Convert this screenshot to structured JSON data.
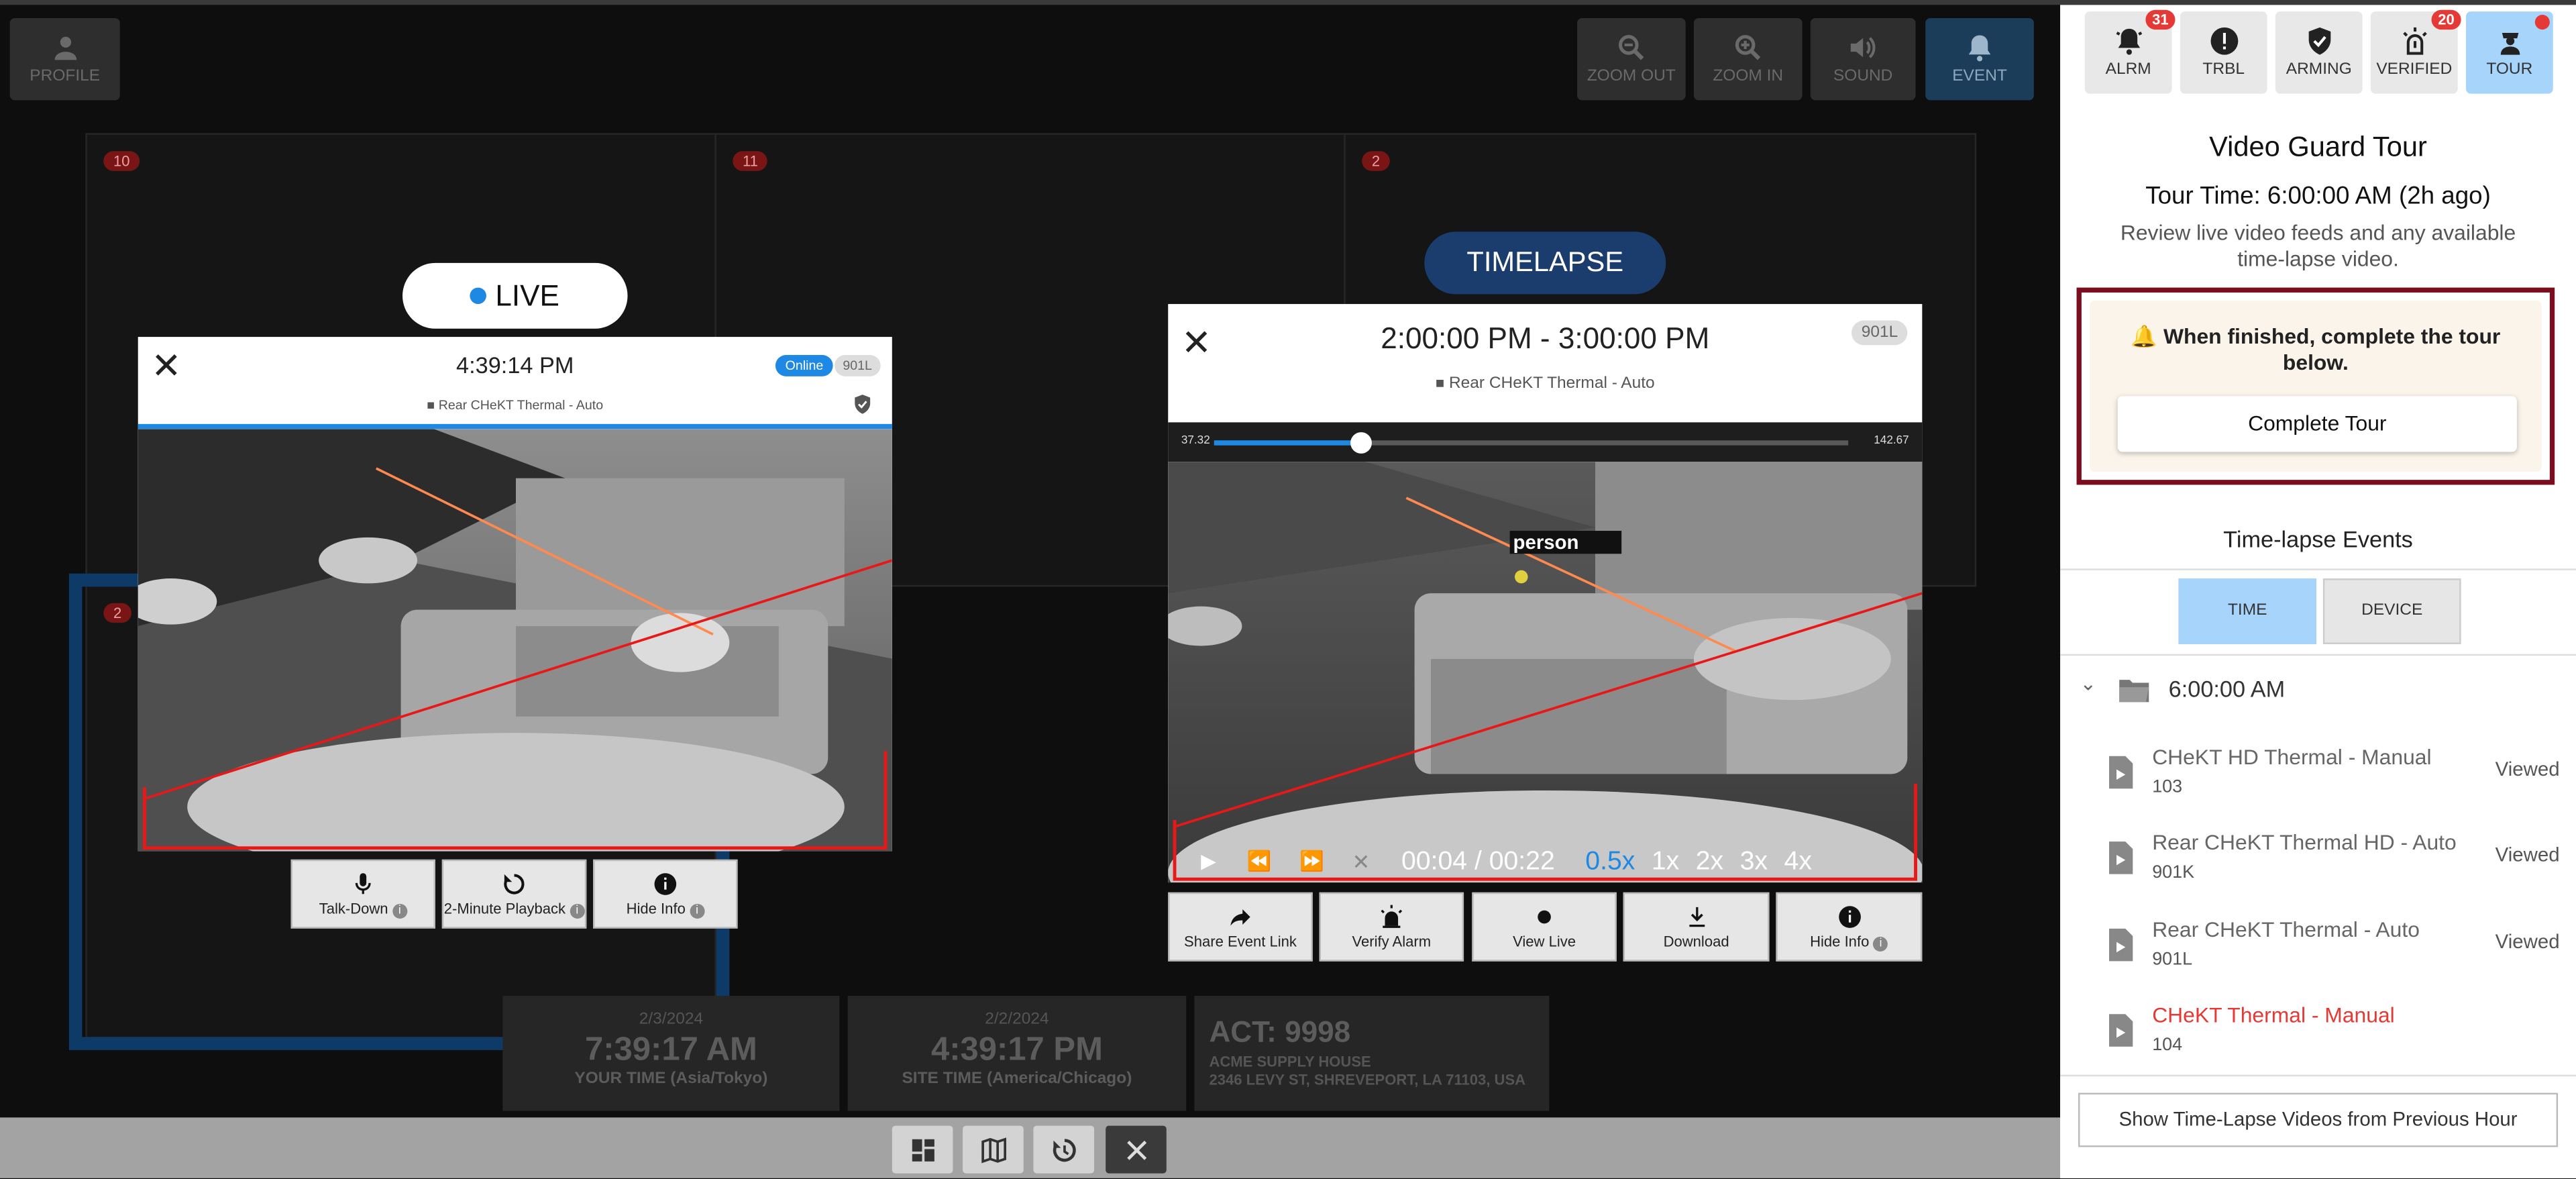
{
  "toolbar": {
    "profile": "PROFILE",
    "zoom_out": "ZOOM OUT",
    "zoom_in": "ZOOM IN",
    "sound": "SOUND",
    "event": "EVENT"
  },
  "grid": {
    "tile_nums": [
      "10",
      "11",
      "2",
      "2"
    ]
  },
  "live": {
    "pill": "LIVE",
    "time": "4:39:14 PM",
    "status": "Online",
    "device": "901L",
    "camera": "Rear CHeKT Thermal - Auto",
    "buttons": {
      "talk": "Talk-Down",
      "playback": "2-Minute Playback",
      "hide": "Hide Info"
    }
  },
  "timelapse": {
    "pill": "TIMELAPSE",
    "range": "2:00:00 PM - 3:00:00 PM",
    "device": "901L",
    "camera": "Rear CHeKT Thermal - Auto",
    "slider_min": "37.32",
    "slider_max": "142.67",
    "slider_progress": 0.23,
    "detect_label": "person",
    "playtime": "00:04 / 00:22",
    "speeds": [
      "0.5x",
      "1x",
      "2x",
      "3x",
      "4x"
    ],
    "active_speed": "0.5x",
    "buttons": {
      "share": "Share Event Link",
      "verify": "Verify Alarm",
      "live": "View Live",
      "download": "Download",
      "hide": "Hide Info"
    }
  },
  "info": {
    "your_date": "2/3/2024",
    "your_time": "7:39:17 AM",
    "your_zone": "YOUR TIME (Asia/Tokyo)",
    "site_date": "2/2/2024",
    "site_time": "4:39:17 PM",
    "site_zone": "SITE TIME (America/Chicago)",
    "account": "ACT: 9998",
    "company": "ACME SUPPLY HOUSE",
    "address": "2346 LEVY ST, SHREVEPORT, LA 71103, USA"
  },
  "sidebar": {
    "tabs": [
      {
        "label": "ALRM",
        "badge": "31"
      },
      {
        "label": "TRBL",
        "badge": ""
      },
      {
        "label": "ARMING",
        "badge": ""
      },
      {
        "label": "VERIFIED",
        "badge": "20"
      },
      {
        "label": "TOUR",
        "badge": ""
      }
    ],
    "title": "Video Guard Tour",
    "tour_time": "Tour Time: 6:00:00 AM (2h ago)",
    "description": "Review live video feeds and any available time-lapse video.",
    "notice": "When finished, complete the tour below.",
    "complete_button": "Complete Tour",
    "events_title": "Time-lapse Events",
    "filter_time": "TIME",
    "filter_device": "DEVICE",
    "folder_time": "6:00:00 AM",
    "events": [
      {
        "name": "CHeKT HD Thermal - Manual",
        "code": "103",
        "status": "Viewed"
      },
      {
        "name": "Rear CHeKT Thermal HD - Auto",
        "code": "901K",
        "status": "Viewed"
      },
      {
        "name": "Rear CHeKT Thermal - Auto",
        "code": "901L",
        "status": "Viewed"
      },
      {
        "name": "CHeKT Thermal - Manual",
        "code": "104",
        "status": ""
      }
    ],
    "prev_hour_button": "Show Time-Lapse Videos from Previous Hour"
  },
  "colors": {
    "accent_blue": "#1e88e5",
    "tour_active": "#a6d4fa",
    "alert_red": "#e53935",
    "highlight_border": "#7b0d1e"
  }
}
